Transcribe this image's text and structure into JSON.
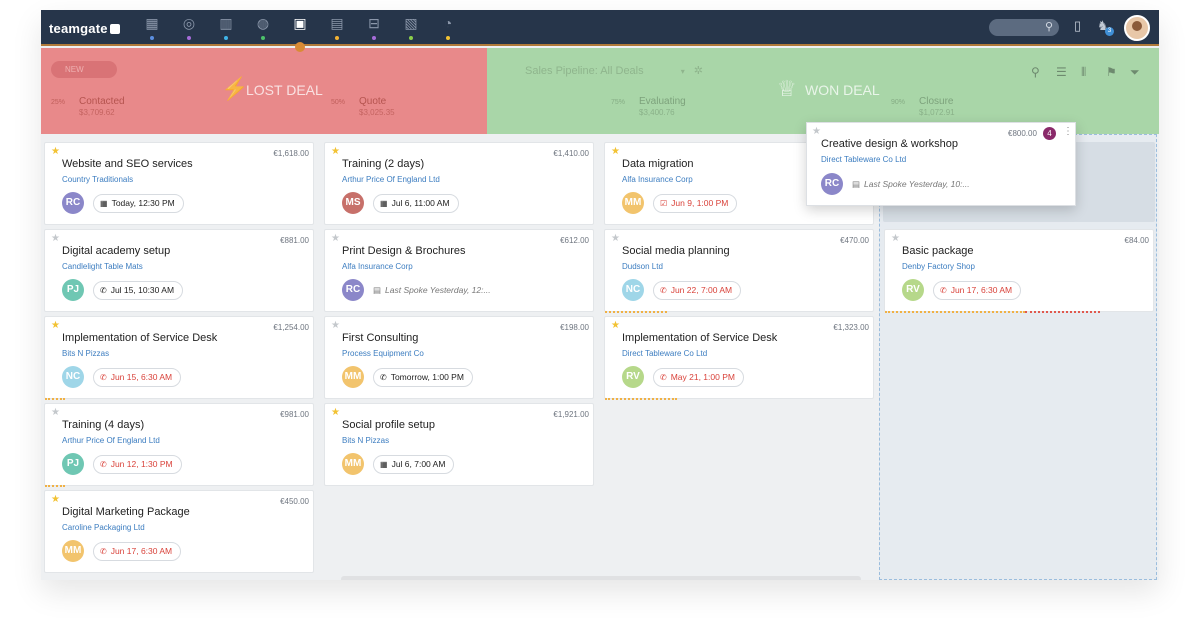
{
  "app": {
    "logo": "teamgate"
  },
  "nav": {
    "icons": [
      {
        "name": "dashboard-icon",
        "glyph": "▦",
        "dot": "#5b8fe0"
      },
      {
        "name": "target-icon",
        "glyph": "◎",
        "dot": "#a66cd9"
      },
      {
        "name": "building-icon",
        "glyph": "▥",
        "dot": "#3fb4e8"
      },
      {
        "name": "dashboard-gauge-icon",
        "glyph": "◍",
        "dot": "#4cc26a"
      },
      {
        "name": "briefcase-icon",
        "glyph": "▣",
        "dot": "#d98b35",
        "active": true
      },
      {
        "name": "calendar-icon",
        "glyph": "▤",
        "dot": "#f2b233"
      },
      {
        "name": "lock-icon",
        "glyph": "⊟",
        "dot": "#a66cd9"
      },
      {
        "name": "documents-icon",
        "glyph": "▧",
        "dot": "#8ccf4a"
      },
      {
        "name": "pie-chart-icon",
        "glyph": "◔",
        "dot": "#f2c233"
      }
    ],
    "notifications_count": "3"
  },
  "header": {
    "new_button": "NEW",
    "lost_label": "LOST DEAL",
    "won_label": "WON DEAL",
    "pipeline_label": "Sales Pipeline: All Deals"
  },
  "stages": [
    {
      "pct": "25%",
      "name": "Contacted",
      "amount": "$3,709.62"
    },
    {
      "pct": "50%",
      "name": "Quote",
      "amount": "$3,025.35"
    },
    {
      "pct": "75%",
      "name": "Evaluating",
      "amount": "$3,400.76"
    },
    {
      "pct": "90%",
      "name": "Closure",
      "amount": "$1,072.91"
    }
  ],
  "cards": {
    "c0": [
      {
        "title": "Website and SEO services",
        "company": "Country Traditionals",
        "amount": "€1,618.00",
        "initials": "RC",
        "when": "Today, 12:30 PM"
      },
      {
        "title": "Digital academy setup",
        "company": "Candlelight Table Mats",
        "amount": "€881.00",
        "initials": "PJ",
        "when": "Jul 15, 10:30 AM"
      },
      {
        "title": "Implementation of Service Desk",
        "company": "Bits N Pizzas",
        "amount": "€1,254.00",
        "initials": "NC",
        "when": "Jun 15, 6:30 AM"
      },
      {
        "title": "Training (4 days)",
        "company": "Arthur Price Of England Ltd",
        "amount": "€981.00",
        "initials": "PJ",
        "when": "Jun 12, 1:30 PM"
      },
      {
        "title": "Digital Marketing Package",
        "company": "Caroline Packaging Ltd",
        "amount": "€450.00",
        "initials": "MM",
        "when": "Jun 17, 6:30 AM"
      }
    ],
    "c1": [
      {
        "title": "Training (2 days)",
        "company": "Arthur Price Of England Ltd",
        "amount": "€1,410.00",
        "initials": "MS",
        "when": "Jul 6, 11:00 AM"
      },
      {
        "title": "Print Design & Brochures",
        "company": "Alfa Insurance Corp",
        "amount": "€612.00",
        "initials": "RC",
        "when": "Last Spoke Yesterday, 12:..."
      },
      {
        "title": "First Consulting",
        "company": "Process Equipment Co",
        "amount": "€198.00",
        "initials": "MM",
        "when": "Tomorrow, 1:00 PM"
      },
      {
        "title": "Social profile setup",
        "company": "Bits N Pizzas",
        "amount": "€1,921.00",
        "initials": "MM",
        "when": "Jul 6, 7:00 AM"
      }
    ],
    "c2": [
      {
        "title": "Data migration",
        "company": "Alfa Insurance Corp",
        "amount": "",
        "initials": "MM",
        "when": "Jun 9, 1:00 PM"
      },
      {
        "title": "Social media planning",
        "company": "Dudson Ltd",
        "amount": "€470.00",
        "initials": "NC",
        "when": "Jun 22, 7:00 AM"
      },
      {
        "title": "Implementation of Service Desk",
        "company": "Direct Tableware Co Ltd",
        "amount": "€1,323.00",
        "initials": "RV",
        "when": "May 21, 1:00 PM"
      }
    ],
    "c3": [
      {
        "title": "Basic package",
        "company": "Denby Factory Shop",
        "amount": "€84.00",
        "initials": "RV",
        "when": "Jun 17, 6:30 AM"
      }
    ]
  },
  "dragging": {
    "title": "Creative design & workshop",
    "company": "Direct Tableware Co Ltd",
    "amount": "€800.00",
    "count": "4",
    "initials": "RC",
    "when": "Last Spoke Yesterday, 10:..."
  },
  "colors": {
    "lost": "#e8898a",
    "won": "#a9d6a8",
    "link": "#3c7dc0",
    "overdue": "#d9423a"
  }
}
